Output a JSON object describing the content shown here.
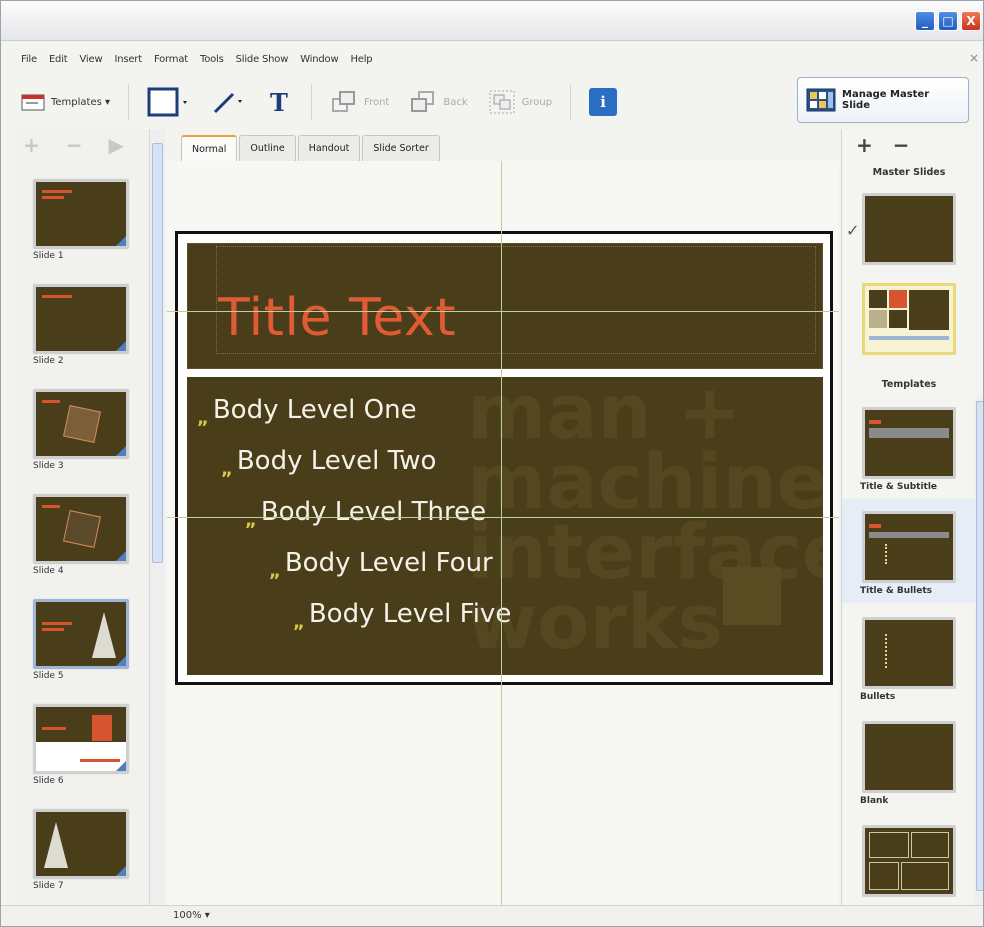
{
  "window": {
    "controls": [
      "_",
      "□",
      "X"
    ]
  },
  "menu": {
    "items": [
      "File",
      "Edit",
      "View",
      "Insert",
      "Format",
      "Tools",
      "Slide Show",
      "Window",
      "Help"
    ],
    "close": "×"
  },
  "toolbar": {
    "templates_label": "Templates ▾",
    "front_label": "Front",
    "back_label": "Back",
    "group_label": "Group",
    "info_label": "i",
    "manage_master_label": "Manage Master Slide"
  },
  "left_panel": {
    "add": "+",
    "remove": "−",
    "play": "▶",
    "slides": [
      {
        "label": "Slide 1"
      },
      {
        "label": "Slide 2"
      },
      {
        "label": "Slide 3"
      },
      {
        "label": "Slide 4"
      },
      {
        "label": "Slide 5"
      },
      {
        "label": "Slide 6"
      },
      {
        "label": "Slide 7"
      }
    ]
  },
  "tabs": [
    "Normal",
    "Outline",
    "Handout",
    "Slide Sorter"
  ],
  "slide": {
    "title": "Title Text",
    "bullets": [
      "Body Level One",
      "Body Level Two",
      "Body Level Three",
      "Body Level Four",
      "Body Level Five"
    ],
    "bullet_mark": "„",
    "watermark_lines": [
      "man +",
      "machine",
      "interface",
      "works"
    ]
  },
  "status": {
    "zoom": "100% ▾"
  },
  "right_panel": {
    "add": "+",
    "remove": "−",
    "master_slides_label": "Master Slides",
    "templates_label": "Templates",
    "check": "✓",
    "templates": [
      {
        "label": "Title & Subtitle"
      },
      {
        "label": "Title & Bullets"
      },
      {
        "label": "Bullets"
      },
      {
        "label": "Blank"
      },
      {
        "label": ""
      }
    ]
  },
  "colors": {
    "slide_bg": "#4a3d1a",
    "title": "#e05b34",
    "bullet": "#d9c84a",
    "accent_blue": "#2a6ec3"
  }
}
